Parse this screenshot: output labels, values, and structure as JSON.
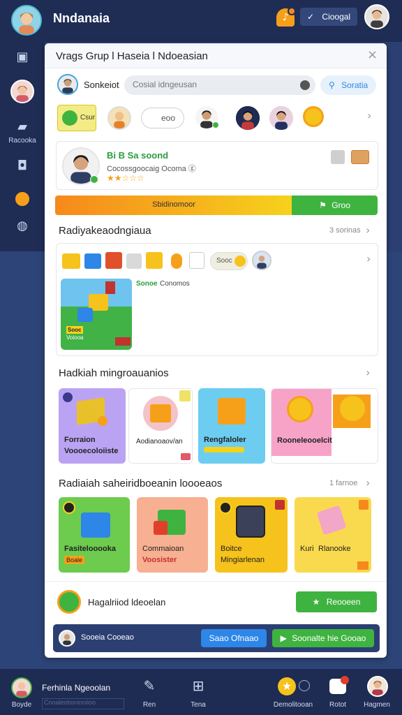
{
  "app": {
    "title": "Nndanaia"
  },
  "topbar": {
    "action_label": "Cioogal"
  },
  "sidebar": {
    "label": "Racooka"
  },
  "panel": {
    "title": "Vrags Grup l Haseia l Ndoeasian",
    "close_glyph": "×",
    "search": {
      "user_label": "Sonkeiot",
      "placeholder": "Cosial idngeusan",
      "button_label": "Soratia"
    },
    "chips": {
      "first_label": "Csur",
      "mid_label": "eoo"
    },
    "profile": {
      "name": "Bi B Sa soond",
      "subtitle": "Cocossgoocaig Ocoma ⓖ",
      "stars": "★★☆☆☆"
    },
    "progress": {
      "label": "Sbidinomoor",
      "button_label": "Groo"
    },
    "section1": {
      "title": "Radiyakeaodngiaua",
      "more": "3 sorinas",
      "pill_label": "Sooc",
      "card_title": "Sonoe",
      "card_sub": "Conomos",
      "thumb_line1": "Sooc",
      "thumb_line2": "Voiooa"
    },
    "section2": {
      "title": "Hadkiah mingroauanios",
      "tiles": [
        {
          "line1": "Forraion",
          "line2": "Voooecoloiiste"
        },
        {
          "line1": "Aodianoaov/an",
          "line2": ""
        },
        {
          "line1": "Rengfaloler",
          "line2": ""
        },
        {
          "line1": "Rooneleooelcit",
          "line2": ""
        }
      ]
    },
    "section3": {
      "title": "Radiaiah saheiridboeanin loooeaos",
      "more": "1 farnoe",
      "tiles": [
        {
          "line1": "Fasitelooooka",
          "line2": "Boale"
        },
        {
          "line1": "Commaioan",
          "line2": "Voosister"
        },
        {
          "line1": "Boitce",
          "line2": "Mingiarlenan"
        },
        {
          "line1": "Kuri",
          "line2": "Rlanooke"
        }
      ]
    },
    "footer": {
      "label": "Hagalriiod ldeoelan",
      "button_label": "Reooeen"
    },
    "bottom_bar": {
      "user_label": "Sooeia Cooeao",
      "blue_button": "Saao Ofnaao",
      "green_button": "Soonalte hie Gooao"
    }
  },
  "bottom_nav": {
    "user_label": "Boyde",
    "user_title": "Ferhinla Ngeoolan",
    "user_sub": "Cnoaleotioninniioo",
    "items": [
      {
        "icon": "pen-icon",
        "label": "Ren"
      },
      {
        "icon": "plus-box-icon",
        "label": "Tena"
      },
      {
        "icon": "star-icon",
        "label": "Demolitooan"
      },
      {
        "icon": "camera-icon",
        "label": "Rotot"
      },
      {
        "icon": "avatar-icon",
        "label": "Hagmen"
      }
    ]
  },
  "colors": {
    "accent_green": "#3fb340",
    "accent_blue": "#2d86e8",
    "navy": "#1f2d55",
    "orange": "#f6a019"
  }
}
